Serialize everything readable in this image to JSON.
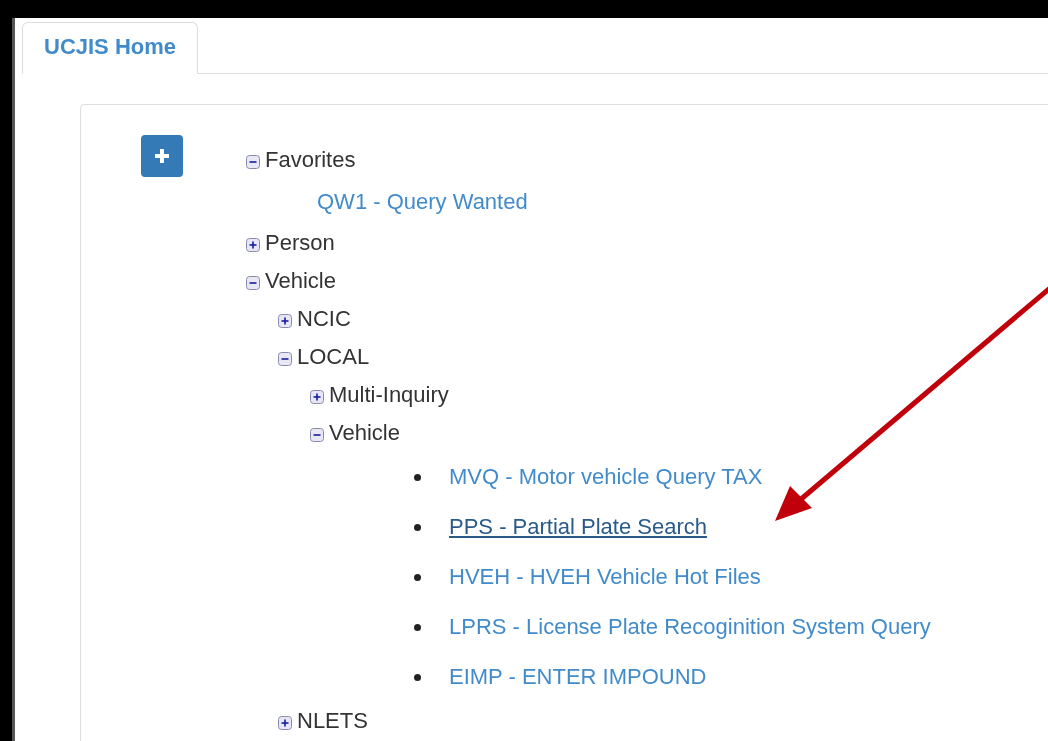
{
  "tabs": [
    {
      "label": "UCJIS Home",
      "selected": true
    }
  ],
  "tree": [
    {
      "kind": "folder",
      "label": "Favorites",
      "expanded": true,
      "children": [
        {
          "kind": "link",
          "label": "QW1 - Query Wanted",
          "hovered": false
        }
      ]
    },
    {
      "kind": "folder",
      "label": "Person",
      "expanded": false
    },
    {
      "kind": "folder",
      "label": "Vehicle",
      "expanded": true,
      "children": [
        {
          "kind": "folder",
          "label": "NCIC",
          "expanded": false
        },
        {
          "kind": "folder",
          "label": "LOCAL",
          "expanded": true,
          "children": [
            {
              "kind": "folder",
              "label": "Multi-Inquiry",
              "expanded": false
            },
            {
              "kind": "folder",
              "label": "Vehicle",
              "expanded": true,
              "children": [
                {
                  "kind": "bullet_link",
                  "label": "MVQ - Motor vehicle Query TAX",
                  "hovered": false
                },
                {
                  "kind": "bullet_link",
                  "label": "PPS - Partial Plate Search",
                  "hovered": true
                },
                {
                  "kind": "bullet_link",
                  "label": "HVEH - HVEH Vehicle Hot Files",
                  "hovered": false
                },
                {
                  "kind": "bullet_link",
                  "label": "LPRS - License Plate Recoginition System Query",
                  "hovered": false
                },
                {
                  "kind": "bullet_link",
                  "label": "EIMP - ENTER IMPOUND",
                  "hovered": false
                }
              ]
            }
          ]
        },
        {
          "kind": "folder",
          "label": "NLETS",
          "expanded": false
        }
      ]
    }
  ]
}
